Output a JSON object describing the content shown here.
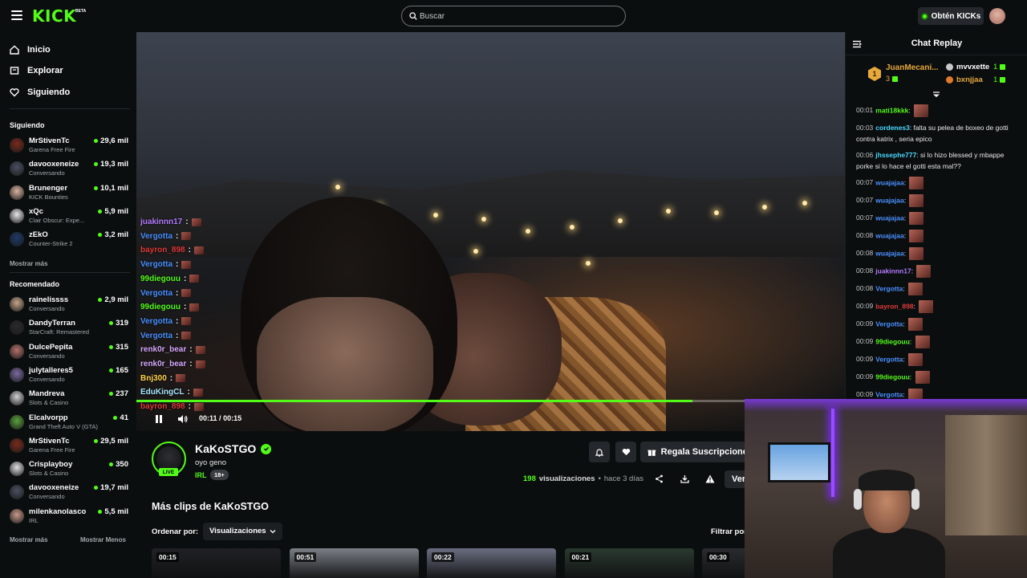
{
  "header": {
    "logo": "KICK",
    "logo_badge": "BETA",
    "search_placeholder": "Buscar",
    "kicks_button": "Obtén KICKs"
  },
  "sidebar": {
    "nav": [
      {
        "label": "Inicio",
        "icon": "home-icon"
      },
      {
        "label": "Explorar",
        "icon": "compass-icon"
      },
      {
        "label": "Siguiendo",
        "icon": "heart-icon"
      }
    ],
    "following_title": "Siguiendo",
    "following": [
      {
        "name": "MrStivenTc",
        "category": "Garena Free Fire",
        "viewers": "29,6 mil",
        "color": "#7a2a1c"
      },
      {
        "name": "davooxeneize",
        "category": "Conversando",
        "viewers": "19,3 mil",
        "color": "#4a5060"
      },
      {
        "name": "Brunenger",
        "category": "KICK Bounties",
        "viewers": "10,1 mil",
        "color": "#d8b4a0"
      },
      {
        "name": "xQc",
        "category": "Clair Obscur: Expe...",
        "viewers": "5,9 mil",
        "color": "#e8e8e8"
      },
      {
        "name": "zEkO",
        "category": "Counter-Strike 2",
        "viewers": "3,2 mil",
        "color": "#1d3a6a"
      }
    ],
    "show_more": "Mostrar más",
    "recommended_title": "Recomendado",
    "recommended": [
      {
        "name": "rainelissss",
        "category": "Conversando",
        "viewers": "2,9 mil",
        "color": "#c7a58a"
      },
      {
        "name": "DandyTerran",
        "category": "StarCraft: Remastered",
        "viewers": "319",
        "color": "#2a2a2a"
      },
      {
        "name": "DulcePepita",
        "category": "Conversando",
        "viewers": "315",
        "color": "#b4706a"
      },
      {
        "name": "julytalleres5",
        "category": "Conversando",
        "viewers": "165",
        "color": "#7a6aa0"
      },
      {
        "name": "Mandreva",
        "category": "Slots & Casino",
        "viewers": "237",
        "color": "#d0d0d0"
      },
      {
        "name": "Elcalvorpp",
        "category": "Grand Theft Auto V (GTA)",
        "viewers": "41",
        "color": "#5aa03a"
      },
      {
        "name": "MrStivenTc",
        "category": "Garena Free Fire",
        "viewers": "29,5 mil",
        "color": "#7a2a1c"
      },
      {
        "name": "Crisplayboy",
        "category": "Slots & Casino",
        "viewers": "350",
        "color": "#e0e0e0"
      },
      {
        "name": "davooxeneize",
        "category": "Conversando",
        "viewers": "19,7 mil",
        "color": "#4a5060"
      },
      {
        "name": "milenkanolasco",
        "category": "IRL",
        "viewers": "5,5 mil",
        "color": "#c89a88"
      }
    ],
    "footer_more": "Mostrar más",
    "footer_less": "Mostrar Menos"
  },
  "video": {
    "overlay_chat": [
      {
        "user": "juakinnn17",
        "color": "#b47bff"
      },
      {
        "user": "Vergotta",
        "color": "#4a90ff"
      },
      {
        "user": "bayron_898",
        "color": "#e03a3a"
      },
      {
        "user": "Vergotta",
        "color": "#4a90ff"
      },
      {
        "user": "99diegouu",
        "color": "#53fc18"
      },
      {
        "user": "Vergotta",
        "color": "#4a90ff"
      },
      {
        "user": "99diegouu",
        "color": "#53fc18"
      },
      {
        "user": "Vergotta",
        "color": "#4a90ff"
      },
      {
        "user": "Vergotta",
        "color": "#4a90ff"
      },
      {
        "user": "renk0r_bear",
        "color": "#d6a8ff"
      },
      {
        "user": "renk0r_bear",
        "color": "#d6a8ff"
      },
      {
        "user": "Bnj300",
        "color": "#ffd24a"
      },
      {
        "user": "EduKingCL",
        "color": "#a8e8ff"
      },
      {
        "user": "bayron_898",
        "color": "#e03a3a"
      }
    ],
    "current_time": "00:11",
    "separator": "/",
    "duration": "00:15",
    "progress": 0.785
  },
  "stream": {
    "name": "KaKoSTGO",
    "title": "oyo geno",
    "category": "IRL",
    "age_tag": "18+",
    "live_badge": "LIVE",
    "gift_button": "Regala Suscripciones",
    "views_count": "198",
    "views_label": "visualizaciones",
    "time_ago": "hace 3 días",
    "follow_button": "Ver"
  },
  "clips": {
    "heading": "Más clips de KaKoSTGO",
    "order_label": "Ordenar por:",
    "order_value": "Visualizaciones",
    "filter_label": "Filtrar por",
    "items": [
      {
        "duration": "00:15",
        "color": "#1f2124"
      },
      {
        "duration": "00:51",
        "color": "#7a7f86"
      },
      {
        "duration": "00:22",
        "color": "#6a6e80"
      },
      {
        "duration": "00:21",
        "color": "#2a3a30"
      },
      {
        "duration": "00:30",
        "color": "#2a2b2e"
      }
    ]
  },
  "chat": {
    "title": "Chat Replay",
    "top_gifter": {
      "rank": "1",
      "name": "JuanMecani...",
      "count": "3"
    },
    "gifters": [
      {
        "name": "mvvxette",
        "count": "1",
        "color": "#ffffff",
        "gem": "#c9c9c9"
      },
      {
        "name": "bxnjjaa",
        "count": "1",
        "color": "#e7a93b",
        "gem": "#e07a2a"
      }
    ],
    "messages": [
      {
        "time": "00:01",
        "user": "mati18kkk",
        "color": "#53fc18",
        "text": "",
        "emote": true
      },
      {
        "time": "00:03",
        "user": "cordenes3",
        "color": "#4ad8ff",
        "text": "falta su pelea de boxeo de gotti contra katrix , seria epico",
        "emote": false
      },
      {
        "time": "00:06",
        "user": "jhssephe777",
        "color": "#4ad8ff",
        "text": "si lo hizo blessed y mbappe porke si lo hace el gotti esta mal??",
        "emote": false
      },
      {
        "time": "00:07",
        "user": "wuajajaa",
        "color": "#4a90ff",
        "text": "",
        "emote": true
      },
      {
        "time": "00:07",
        "user": "wuajajaa",
        "color": "#4a90ff",
        "text": "",
        "emote": true
      },
      {
        "time": "00:07",
        "user": "wuajajaa",
        "color": "#4a90ff",
        "text": "",
        "emote": true
      },
      {
        "time": "00:08",
        "user": "wuajajaa",
        "color": "#4a90ff",
        "text": "",
        "emote": true
      },
      {
        "time": "00:08",
        "user": "wuajajaa",
        "color": "#4a90ff",
        "text": "",
        "emote": true
      },
      {
        "time": "00:08",
        "user": "juakinnn17",
        "color": "#b47bff",
        "text": "",
        "emote": true
      },
      {
        "time": "00:08",
        "user": "Vergotta",
        "color": "#4a90ff",
        "text": "",
        "emote": true
      },
      {
        "time": "00:09",
        "user": "bayron_898",
        "color": "#e03a3a",
        "text": "",
        "emote": true
      },
      {
        "time": "00:09",
        "user": "Vergotta",
        "color": "#4a90ff",
        "text": "",
        "emote": true
      },
      {
        "time": "00:09",
        "user": "99diegouu",
        "color": "#53fc18",
        "text": "",
        "emote": true
      },
      {
        "time": "00:09",
        "user": "Vergotta",
        "color": "#4a90ff",
        "text": "",
        "emote": true
      },
      {
        "time": "00:09",
        "user": "99diegouu",
        "color": "#53fc18",
        "text": "",
        "emote": true
      },
      {
        "time": "00:09",
        "user": "Vergotta",
        "color": "#4a90ff",
        "text": "",
        "emote": true
      }
    ]
  },
  "colors": {
    "brand_green": "#53fc18",
    "background": "#0b0e0f",
    "button_bg": "#24272c"
  }
}
